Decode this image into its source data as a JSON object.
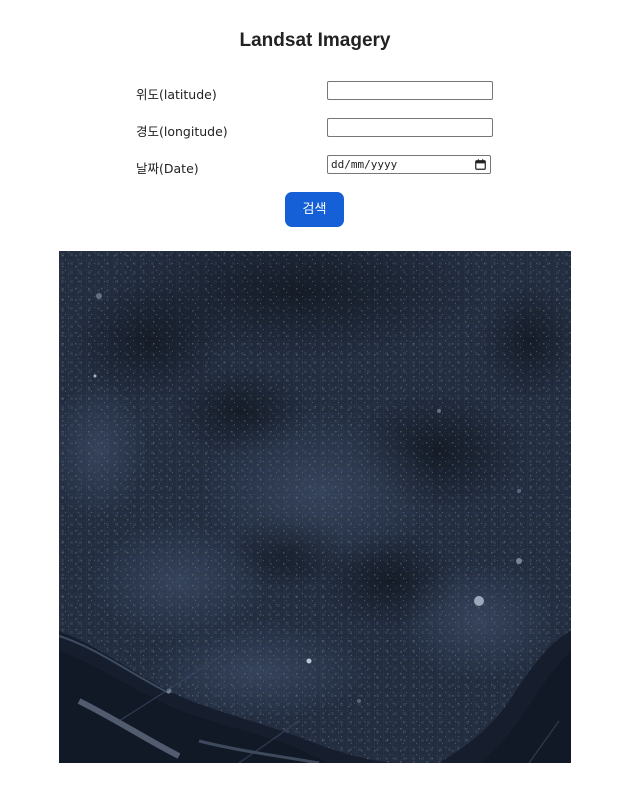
{
  "header": {
    "title": "Landsat Imagery"
  },
  "form": {
    "latitude": {
      "label": "위도(latitude)",
      "value": ""
    },
    "longitude": {
      "label": "경도(longitude)",
      "value": ""
    },
    "date": {
      "label": "날짜(Date)",
      "placeholder": "dd/mm/yyyy",
      "icon": "calendar-icon"
    },
    "search_label": "검색"
  },
  "image": {
    "alt": "Landsat satellite image",
    "colors": {
      "base": "#1f2a3c",
      "land": "#2c3a52",
      "urban": "#4a5a74",
      "dark": "#141c2a",
      "water": "#1a2234",
      "highlight": "#9aa8bd"
    }
  },
  "colors": {
    "accent": "#1560d6"
  }
}
